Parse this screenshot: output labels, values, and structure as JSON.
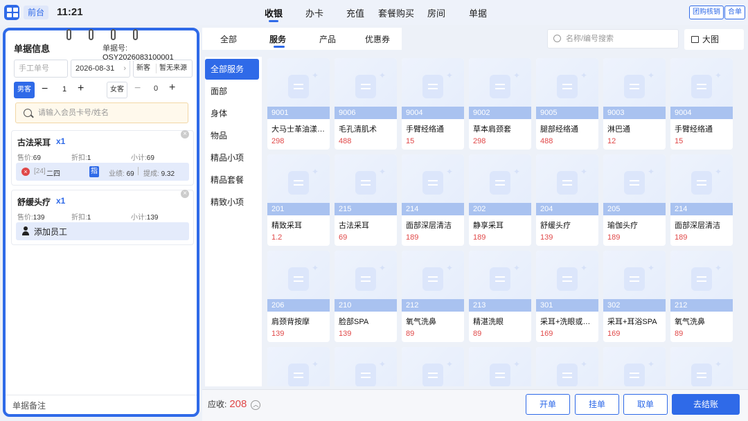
{
  "header": {
    "mode": "前台",
    "time": "11:21",
    "nav": [
      "收银",
      "办卡",
      "充值",
      "套餐购买",
      "房间",
      "单据"
    ],
    "buttons": [
      "团购核销",
      "合单"
    ]
  },
  "order": {
    "title": "单据信息",
    "no_label": "单据号:",
    "no": "QSY2026083100001",
    "manual_placeholder": "手工单号",
    "date": "2026-08-31",
    "new_customer": "新客",
    "source": "暂无来源",
    "male": "男客",
    "male_count": "1",
    "female": "女客",
    "female_count": "0",
    "member_placeholder": "请输入会员卡号/姓名",
    "items": [
      {
        "name": "古法采耳",
        "qty": "x1",
        "price_label": "售价:",
        "price": "69",
        "discount_label": "折扣:",
        "discount": "1",
        "subtotal_label": "小计:",
        "subtotal": "69",
        "staff_id": "[24]",
        "staff_name": "二四",
        "staff_tag": "指",
        "perf_label": "业绩:",
        "perf": "69",
        "commission_label": "提成:",
        "commission": "9.32"
      },
      {
        "name": "舒缓头疗",
        "qty": "x1",
        "price_label": "售价:",
        "price": "139",
        "discount_label": "折扣:",
        "discount": "1",
        "subtotal_label": "小计:",
        "subtotal": "139",
        "add_staff": "添加员工"
      }
    ],
    "note": "单据备注"
  },
  "tabs": [
    "全部",
    "服务",
    "产品",
    "优惠券"
  ],
  "search_placeholder": "名称/编号搜索",
  "big_image": "大图",
  "categories": [
    "全部服务",
    "面部",
    "身体",
    "物品",
    "精品小项",
    "精品套餐",
    "精致小项"
  ],
  "products": [
    {
      "code": "9001",
      "name": "大马士革油漾…",
      "price": "298"
    },
    {
      "code": "9006",
      "name": "毛孔清肌术",
      "price": "488"
    },
    {
      "code": "9004",
      "name": "手臂经络通",
      "price": "15"
    },
    {
      "code": "9002",
      "name": "草本肩颈套",
      "price": "298"
    },
    {
      "code": "9005",
      "name": "腿部经络通",
      "price": "488"
    },
    {
      "code": "9003",
      "name": "淋巴通",
      "price": "12"
    },
    {
      "code": "9004",
      "name": "手臂经络通",
      "price": "15"
    },
    {
      "code": "201",
      "name": "精致采耳",
      "price": "1.2"
    },
    {
      "code": "215",
      "name": "古法采耳",
      "price": "69"
    },
    {
      "code": "214",
      "name": "面部深层清洁",
      "price": "189"
    },
    {
      "code": "202",
      "name": "静享采耳",
      "price": "189"
    },
    {
      "code": "204",
      "name": "舒缓头疗",
      "price": "139"
    },
    {
      "code": "205",
      "name": "瑜伽头疗",
      "price": "189"
    },
    {
      "code": "214",
      "name": "面部深层清洁",
      "price": "189"
    },
    {
      "code": "206",
      "name": "肩颈背按摩",
      "price": "139"
    },
    {
      "code": "210",
      "name": "脸部SPA",
      "price": "139"
    },
    {
      "code": "212",
      "name": "氧气洗鼻",
      "price": "89"
    },
    {
      "code": "213",
      "name": "精湛洗眼",
      "price": "89"
    },
    {
      "code": "301",
      "name": "采耳+洗眼或…",
      "price": "169"
    },
    {
      "code": "302",
      "name": "采耳+耳浴SPA",
      "price": "169"
    },
    {
      "code": "212",
      "name": "氧气洗鼻",
      "price": "89"
    }
  ],
  "footer": {
    "due_label": "应收:",
    "due": "208",
    "buttons": [
      "开单",
      "挂单",
      "取单",
      "去结账"
    ]
  },
  "colors": {
    "accent": "#2f6ae8",
    "price": "#e04848"
  }
}
